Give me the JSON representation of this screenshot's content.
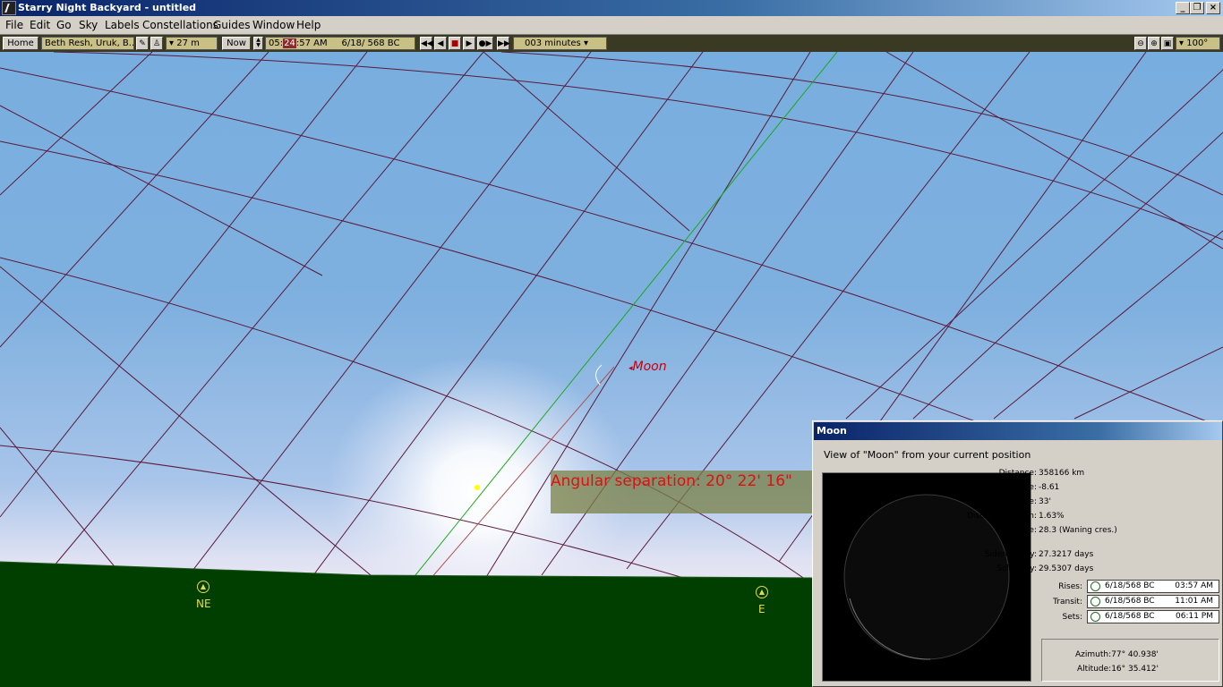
{
  "window": {
    "title": "Starry Night Backyard - untitled"
  },
  "menu": [
    "File",
    "Edit",
    "Go",
    "Sky",
    "Labels",
    "Constellations",
    "Guides",
    "Window",
    "Help"
  ],
  "toolbar": {
    "home_label": "Home",
    "location": "Beth Resh, Uruk, B...",
    "elevation": "27 m",
    "now_label": "Now",
    "time_hour": "05",
    "time_minute": "24",
    "time_rest": "57 AM",
    "date": "6/18/  568 BC",
    "step_interval": "003 minutes",
    "fov": "100°"
  },
  "sky": {
    "moon_label": "Moon",
    "angular_separation": "Angular separation: 20° 22' 16\"",
    "compass": [
      {
        "dir": "NE"
      },
      {
        "dir": "E"
      }
    ]
  },
  "panel": {
    "title": "Moon",
    "subtitle": "View of \"Moon\" from your current position",
    "info": [
      {
        "label": "Distance:",
        "value": "358166 km"
      },
      {
        "label": "Magnitude:",
        "value": "-8.61"
      },
      {
        "label": "Angular size:",
        "value": "33'"
      },
      {
        "label": "Disc illumination:",
        "value": "1.63%"
      },
      {
        "label": "Age:",
        "value": "28.3 (Waning cres.)"
      },
      {
        "label": "Sidereal day:",
        "value": "27.3217 days"
      },
      {
        "label": "Solar day:",
        "value": "29.5307 days"
      }
    ],
    "events": [
      {
        "label": "Rises:",
        "date": "6/18/568 BC",
        "time": "03:57 AM"
      },
      {
        "label": "Transit:",
        "date": "6/18/568 BC",
        "time": "11:01 AM"
      },
      {
        "label": "Sets:",
        "date": "6/18/568 BC",
        "time": "06:11 PM"
      }
    ],
    "azimuth": "Azimuth:77° 40.938'",
    "altitude": "Altitude:16° 35.412'"
  },
  "colors": {
    "horizon_ground": "#003f00",
    "grid_line": "#5a1a3a",
    "ecliptic": "#1aa81a",
    "label_red": "#c2000f",
    "compass_yellow": "#e6d84a"
  }
}
